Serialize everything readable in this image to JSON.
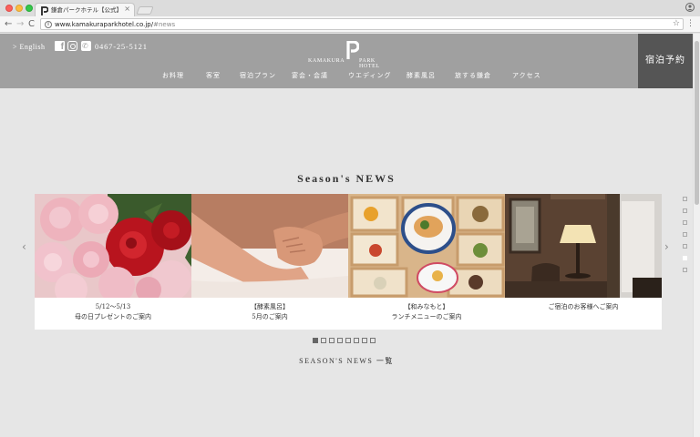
{
  "browser": {
    "tab_title": "鎌倉パークホテル【公式】 KA",
    "tab_close": "×",
    "url_main": "www.kamakuraparkhotel.co.jp/",
    "url_hash": "#news",
    "back": "←",
    "forward": "→",
    "reload": "C",
    "info": "i",
    "star": "☆",
    "menu": "⋮"
  },
  "header": {
    "lang_link": "> English",
    "tel": "0467-25-5121",
    "logo_left": "KAMAKURA",
    "logo_right": "PARK HOTEL",
    "nav": [
      "お料理",
      "客室",
      "宿泊プラン",
      "宴会・会議",
      "ウエディング",
      "酵素風呂",
      "旅する鎌倉",
      "アクセス"
    ],
    "reserve": "宿泊予約",
    "colors": {
      "header_bg": "#a0a0a0",
      "reserve_bg": "#555555"
    }
  },
  "news": {
    "title": "Season's NEWS",
    "cards": [
      {
        "photo": "roses",
        "line1": "5/12～5/13",
        "line2": "母の日プレゼントのご案内"
      },
      {
        "photo": "foot-massage",
        "line1": "【酵素風呂】",
        "line2": "5月のご案内"
      },
      {
        "photo": "bento",
        "line1": "【和みなもと】",
        "line2": "ランチメニューのご案内"
      },
      {
        "photo": "lounge",
        "line1": "ご宿泊のお客様へご案内",
        "line2": ""
      }
    ],
    "prev_arrow": "‹",
    "next_arrow": "›",
    "pager_total": 8,
    "pager_active": 0,
    "list_link": "SEASON'S NEWS 一覧"
  },
  "side_nav": {
    "total": 7,
    "active": 5
  }
}
